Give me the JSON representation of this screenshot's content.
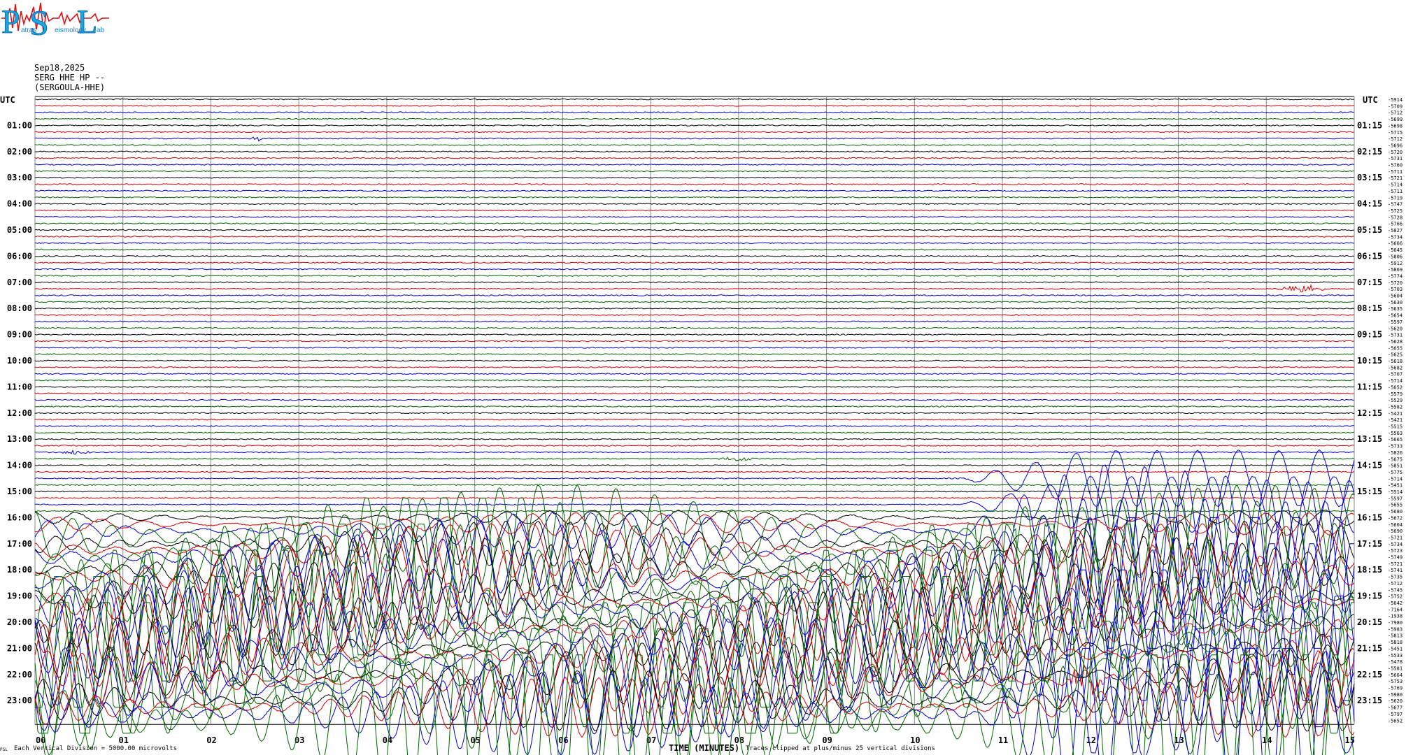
{
  "header": {
    "logo_letters": [
      "P",
      "S",
      "L"
    ],
    "logo_words": [
      "atras",
      "eismology",
      "ab"
    ],
    "date": "Sep18,2025",
    "station": "SERG HHE HP --",
    "station_name": "(SERGOULA-HHE)"
  },
  "footer": {
    "scale_note": "Each Vertical Division = 5000.00 microvolts",
    "clip_note": "Traces clipped at plus/minus 25 vertical divisions"
  },
  "chart_data": {
    "type": "helicorder",
    "xlabel": "TIME (MINUTES)",
    "xlim": [
      0,
      15
    ],
    "x_ticks": [
      "00",
      "01",
      "02",
      "03",
      "04",
      "05",
      "06",
      "07",
      "08",
      "09",
      "10",
      "11",
      "12",
      "13",
      "14",
      "15"
    ],
    "y_corner_left": "UTC",
    "y_corner_right": "UTC",
    "minutes_per_line": 15,
    "line_colors": [
      "#000000",
      "#d40000",
      "#0000d4",
      "#006400"
    ],
    "left_labels": [
      "01:00",
      "02:00",
      "03:00",
      "04:00",
      "05:00",
      "06:00",
      "07:00",
      "08:00",
      "09:00",
      "10:00",
      "11:00",
      "12:00",
      "13:00",
      "14:00",
      "15:00",
      "16:00",
      "17:00",
      "18:00",
      "19:00",
      "20:00",
      "21:00",
      "22:00",
      "23:00"
    ],
    "right_labels": [
      "01:15",
      "02:15",
      "03:15",
      "04:15",
      "05:15",
      "06:15",
      "07:15",
      "08:15",
      "09:15",
      "10:15",
      "11:15",
      "12:15",
      "13:15",
      "14:15",
      "15:15",
      "16:15",
      "17:15",
      "18:15",
      "19:15",
      "20:15",
      "21:15",
      "22:15",
      "23:15"
    ],
    "line_means": [
      "-5914",
      "-5709",
      "-5712",
      "-5699",
      "-5698",
      "-5715",
      "-5712",
      "-5696",
      "-5720",
      "-5731",
      "-5760",
      "-5711",
      "-5721",
      "-5714",
      "-5711",
      "-5719",
      "-5747",
      "-5725",
      "-5728",
      "-5766",
      "-5827",
      "-5734",
      "-5666",
      "-5645",
      "-5806",
      "-5912",
      "-5869",
      "-5774",
      "-5720",
      "-5703",
      "-5604",
      "-5630",
      "-5635",
      "-5654",
      "-5597",
      "-5620",
      "-5731",
      "-5628",
      "-5655",
      "-5625",
      "-5618",
      "-5682",
      "-5707",
      "-5714",
      "-5652",
      "-5579",
      "-5529",
      "-5582",
      "-5421",
      "-5421",
      "-5515",
      "-5563",
      "-5665",
      "-5733",
      "-5826",
      "-5675",
      "-5851",
      "-5775",
      "-5714",
      "-5451",
      "-5514",
      "-5597",
      "-5655",
      "-5680",
      "-5672",
      "-5604",
      "-5690",
      "-5721",
      "-5734",
      "-5723",
      "-5749",
      "-5721",
      "-5741",
      "-5735",
      "-5712",
      "-5745",
      "-5752",
      "-5642",
      "-7164",
      "-1938",
      "-7980",
      "-5983",
      "-5813",
      "-5818",
      "-5451",
      "-5533",
      "-5478",
      "-5581",
      "-5664",
      "-5753",
      "-5769",
      "-5980",
      "-5620",
      "-5677",
      "-5797",
      "-5652"
    ],
    "events": [
      {
        "line": 6,
        "minute": 2.52,
        "amplitude": 2,
        "width_min": 0.06
      },
      {
        "line": 29,
        "minute": 14.4,
        "amplitude": 3,
        "width_min": 0.3
      },
      {
        "line": 54,
        "minute": 0.48,
        "amplitude": 2,
        "width_min": 0.2
      },
      {
        "line": 55,
        "minute": 8.0,
        "amplitude": 1.5,
        "width_min": 0.3
      },
      {
        "line": 75,
        "minute": 11.5,
        "amplitude": 6,
        "width_min": 1.5
      },
      {
        "line": 89,
        "minute": 11.95,
        "amplitude": 9,
        "width_min": 0.3
      }
    ],
    "long_period_wave": {
      "start_line": 64,
      "blue_onset_line": 60,
      "description": "large teleseismic surface waves, clipped"
    }
  }
}
